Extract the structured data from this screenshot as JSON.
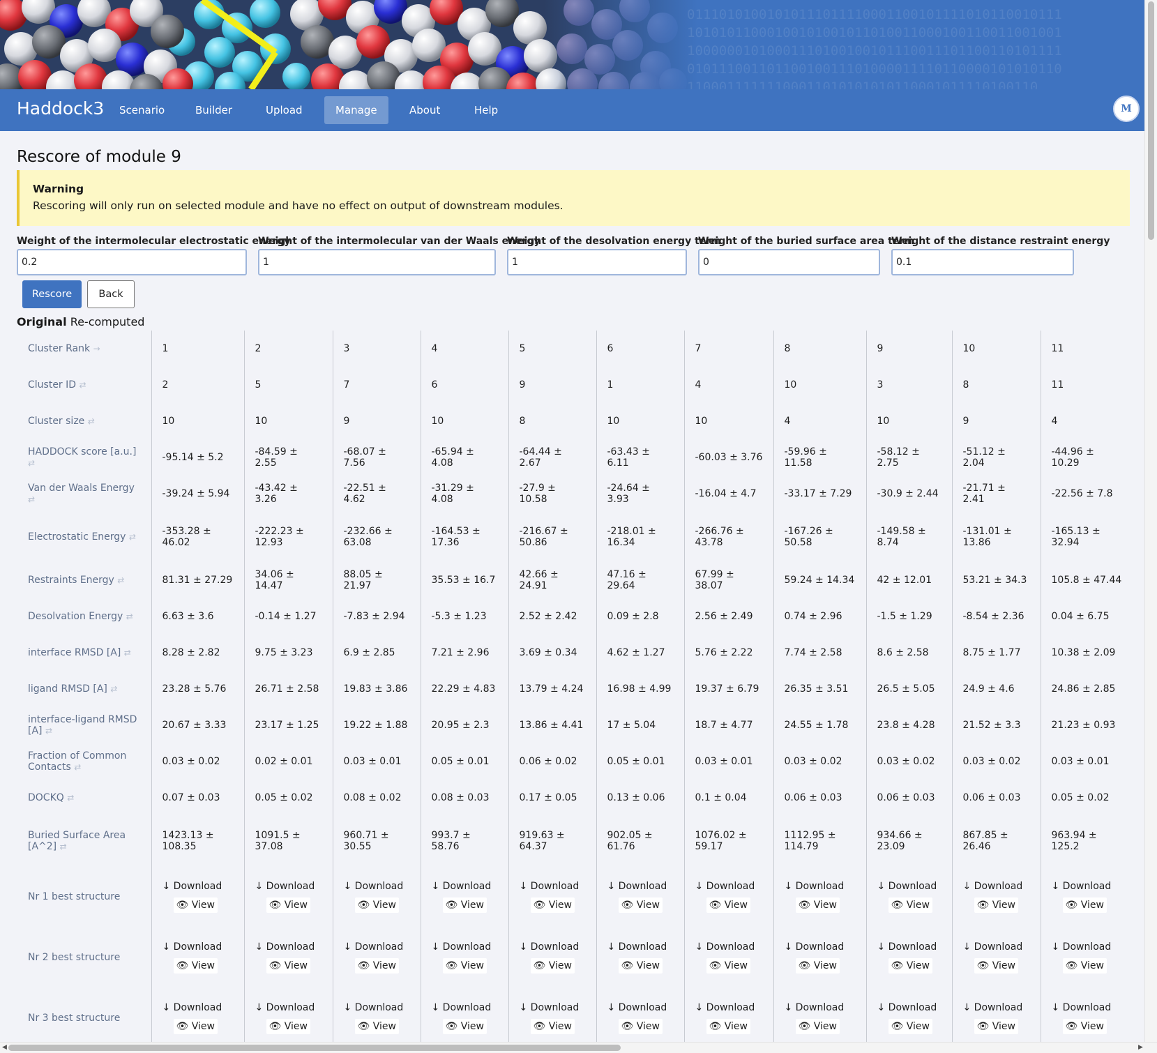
{
  "nav": {
    "brand": "Haddock3",
    "items": [
      "Scenario",
      "Builder",
      "Upload",
      "Manage",
      "About",
      "Help"
    ],
    "active": "Manage",
    "avatar": "M"
  },
  "banner": {
    "binary_lines": [
      "01110101001010111011110001100101111010110010111",
      "10101011000100101001011010011000100110011001001",
      "10000001010001110100100101110011101100110101111",
      "01011100110110010011101000011110110000101010110",
      "11000111111100011010101010110001011110100110"
    ]
  },
  "page": {
    "title": "Rescore of module 9",
    "warning_title": "Warning",
    "warning_text": "Rescoring will only run on selected module and have no effect on output of downstream modules."
  },
  "weights": [
    {
      "label": "Weight of the intermolecular electrostatic energy",
      "value": "0.2"
    },
    {
      "label": "Weight of the intermolecular van der Waals energy",
      "value": "1"
    },
    {
      "label": "Weight of the desolvation energy term",
      "value": "1"
    },
    {
      "label": "Weight of the buried surface area term",
      "value": "0"
    },
    {
      "label": "Weight of the distance restraint energy",
      "value": "0.1"
    }
  ],
  "buttons": {
    "rescore": "Rescore",
    "back": "Back"
  },
  "toggle": {
    "original": "Original",
    "recomputed": "Re-computed"
  },
  "table": {
    "sort_active_icon": "→",
    "sort_icon": "⇄",
    "download_label": "↓ Download",
    "view_label": "👁 View",
    "rows": [
      {
        "label": "Cluster Rank",
        "sort": "active",
        "values": [
          "1",
          "2",
          "3",
          "4",
          "5",
          "6",
          "7",
          "8",
          "9",
          "10",
          "11"
        ]
      },
      {
        "label": "Cluster ID",
        "sort": "sortable",
        "values": [
          "2",
          "5",
          "7",
          "6",
          "9",
          "1",
          "4",
          "10",
          "3",
          "8",
          "11"
        ]
      },
      {
        "label": "Cluster size",
        "sort": "sortable",
        "values": [
          "10",
          "10",
          "9",
          "10",
          "8",
          "10",
          "10",
          "4",
          "10",
          "9",
          "4"
        ]
      },
      {
        "label": "HADDOCK score [a.u.]",
        "sort": "sortable",
        "values": [
          "-95.14 ± 5.2",
          "-84.59 ± 2.55",
          "-68.07 ± 7.56",
          "-65.94 ± 4.08",
          "-64.44 ± 2.67",
          "-63.43 ± 6.11",
          "-60.03 ± 3.76",
          "-59.96 ± 11.58",
          "-58.12 ± 2.75",
          "-51.12 ± 2.04",
          "-44.96 ± 10.29"
        ]
      },
      {
        "label": "Van der Waals Energy",
        "sort": "sortable",
        "values": [
          "-39.24 ± 5.94",
          "-43.42 ± 3.26",
          "-22.51 ± 4.62",
          "-31.29 ± 4.08",
          "-27.9 ± 10.58",
          "-24.64 ± 3.93",
          "-16.04 ± 4.7",
          "-33.17 ± 7.29",
          "-30.9 ± 2.44",
          "-21.71 ± 2.41",
          "-22.56 ± 7.8"
        ]
      },
      {
        "label": "Electrostatic Energy",
        "sort": "sortable",
        "values": [
          "-353.28 ± 46.02",
          "-222.23 ± 12.93",
          "-232.66 ± 63.08",
          "-164.53 ± 17.36",
          "-216.67 ± 50.86",
          "-218.01 ± 16.34",
          "-266.76 ± 43.78",
          "-167.26 ± 50.58",
          "-149.58 ± 8.74",
          "-131.01 ± 13.86",
          "-165.13 ± 32.94"
        ]
      },
      {
        "label": "Restraints Energy",
        "sort": "sortable",
        "values": [
          "81.31 ± 27.29",
          "34.06 ± 14.47",
          "88.05 ± 21.97",
          "35.53 ± 16.7",
          "42.66 ± 24.91",
          "47.16 ± 29.64",
          "67.99 ± 38.07",
          "59.24 ± 14.34",
          "42 ± 12.01",
          "53.21 ± 34.3",
          "105.8 ± 47.44"
        ]
      },
      {
        "label": "Desolvation Energy",
        "sort": "sortable",
        "values": [
          "6.63 ± 3.6",
          "-0.14 ± 1.27",
          "-7.83 ± 2.94",
          "-5.3 ± 1.23",
          "2.52 ± 2.42",
          "0.09 ± 2.8",
          "2.56 ± 2.49",
          "0.74 ± 2.96",
          "-1.5 ± 1.29",
          "-8.54 ± 2.36",
          "0.04 ± 6.75"
        ]
      },
      {
        "label": "interface RMSD [A]",
        "sort": "sortable",
        "values": [
          "8.28 ± 2.82",
          "9.75 ± 3.23",
          "6.9 ± 2.85",
          "7.21 ± 2.96",
          "3.69 ± 0.34",
          "4.62 ± 1.27",
          "5.76 ± 2.22",
          "7.74 ± 2.58",
          "8.6 ± 2.58",
          "8.75 ± 1.77",
          "10.38 ± 2.09"
        ]
      },
      {
        "label": "ligand RMSD [A]",
        "sort": "sortable",
        "values": [
          "23.28 ± 5.76",
          "26.71 ± 2.58",
          "19.83 ± 3.86",
          "22.29 ± 4.83",
          "13.79 ± 4.24",
          "16.98 ± 4.99",
          "19.37 ± 6.79",
          "26.35 ± 3.51",
          "26.5 ± 5.05",
          "24.9 ± 4.6",
          "24.86 ± 2.85"
        ]
      },
      {
        "label": "interface-ligand RMSD [A]",
        "sort": "sortable",
        "values": [
          "20.67 ± 3.33",
          "23.17 ± 1.25",
          "19.22 ± 1.88",
          "20.95 ± 2.3",
          "13.86 ± 4.41",
          "17 ± 5.04",
          "18.7 ± 4.77",
          "24.55 ± 1.78",
          "23.8 ± 4.28",
          "21.52 ± 3.3",
          "21.23 ± 0.93"
        ]
      },
      {
        "label": "Fraction of Common Contacts",
        "sort": "sortable",
        "values": [
          "0.03 ± 0.02",
          "0.02 ± 0.01",
          "0.03 ± 0.01",
          "0.05 ± 0.01",
          "0.06 ± 0.02",
          "0.05 ± 0.01",
          "0.03 ± 0.01",
          "0.03 ± 0.02",
          "0.03 ± 0.02",
          "0.03 ± 0.02",
          "0.03 ± 0.01"
        ]
      },
      {
        "label": "DOCKQ",
        "sort": "sortable",
        "values": [
          "0.07 ± 0.03",
          "0.05 ± 0.02",
          "0.08 ± 0.02",
          "0.08 ± 0.03",
          "0.17 ± 0.05",
          "0.13 ± 0.06",
          "0.1 ± 0.04",
          "0.06 ± 0.03",
          "0.06 ± 0.03",
          "0.06 ± 0.03",
          "0.05 ± 0.02"
        ]
      },
      {
        "label": "Buried Surface Area [A^2]",
        "sort": "sortable",
        "values": [
          "1423.13 ± 108.35",
          "1091.5 ± 37.08",
          "960.71 ± 30.55",
          "993.7 ± 58.76",
          "919.63 ± 64.37",
          "902.05 ± 61.76",
          "1076.02 ± 59.17",
          "1112.95 ± 114.79",
          "934.66 ± 23.09",
          "867.85 ± 26.46",
          "963.94 ± 125.2"
        ]
      }
    ],
    "structure_rows": [
      "Nr 1 best structure",
      "Nr 2 best structure",
      "Nr 3 best structure"
    ]
  },
  "colors": {
    "primary": "#3f73c0",
    "warning_bg": "#fdf8c6",
    "warning_border": "#e9c636",
    "page_bg": "#f2f3f8"
  }
}
